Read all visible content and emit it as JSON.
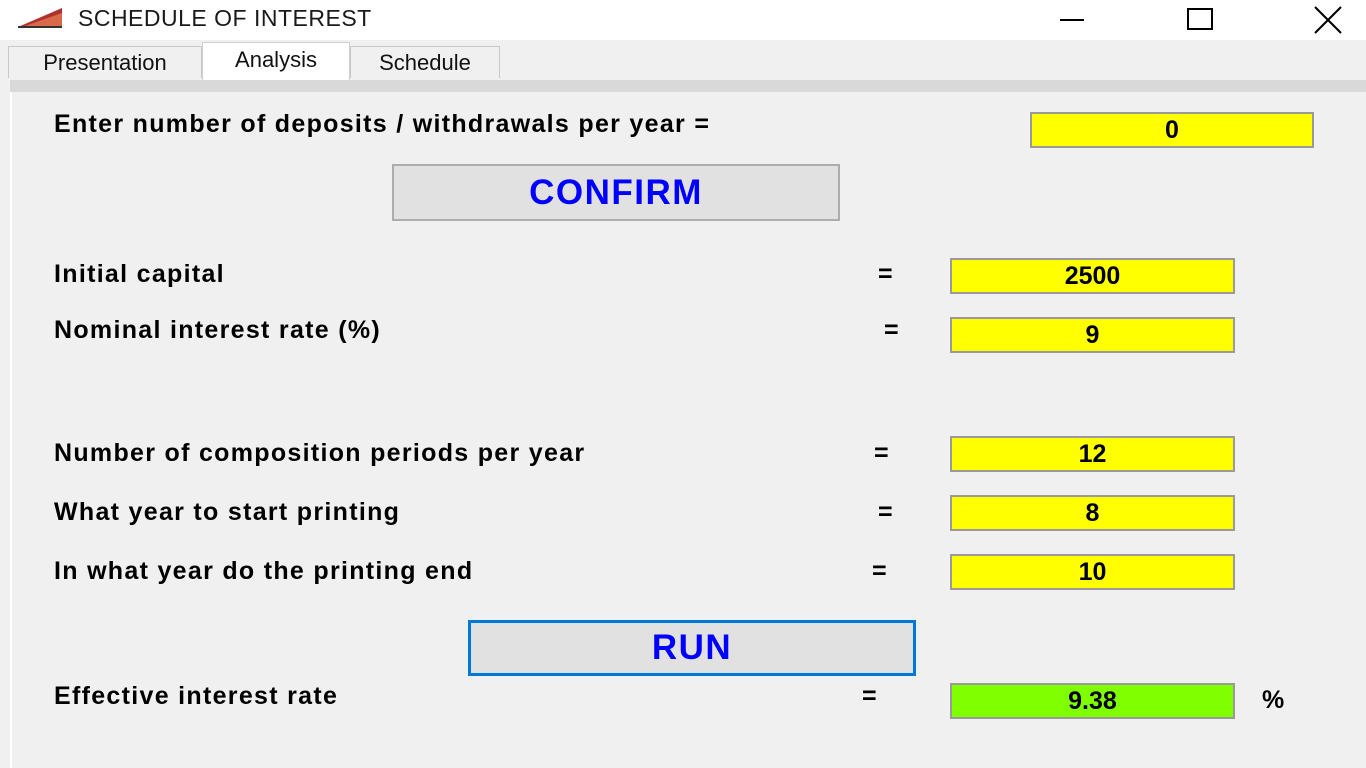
{
  "window": {
    "title": "SCHEDULE OF INTEREST",
    "icon": "chart-icon",
    "controls": {
      "minimize": "—",
      "maximize": "☐",
      "close": "✕"
    }
  },
  "tabs": [
    {
      "label": "Presentation",
      "active": false
    },
    {
      "label": "Analysis",
      "active": true
    },
    {
      "label": "Schedule",
      "active": false
    }
  ],
  "form": {
    "deposits_label": "Enter number of deposits / withdrawals per year =",
    "deposits_value": "0",
    "confirm_label": "CONFIRM",
    "initial_capital_label": "Initial capital",
    "initial_capital_value": "2500",
    "nominal_rate_label": "Nominal interest rate (%)",
    "nominal_rate_value": "9",
    "periods_label": "Number of composition periods per year",
    "periods_value": "12",
    "start_year_label": "What year to start printing",
    "start_year_value": "8",
    "end_year_label": "In what year do the printing end",
    "end_year_value": "10",
    "run_label": "RUN",
    "effective_rate_label": "Effective interest rate",
    "effective_rate_value": "9.38",
    "percent_sign": "%",
    "equals": "="
  },
  "colors": {
    "input_bg": "#ffff00",
    "result_bg": "#80ff00",
    "button_text": "#0000ff",
    "focus_border": "#0078d7"
  }
}
